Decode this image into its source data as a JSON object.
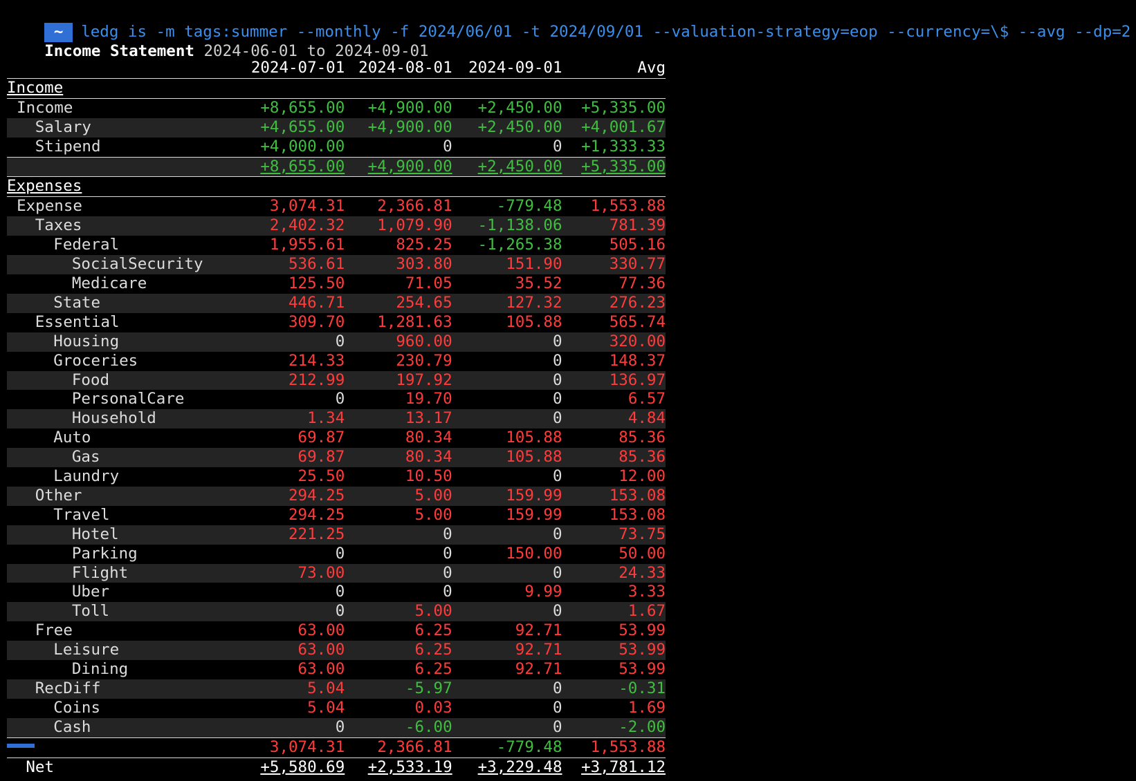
{
  "terminal": {
    "prompt_symbol": "~",
    "command": "ledg is -m tags:summer --monthly -f 2024/06/01 -t 2024/09/01 --valuation-strategy=eop --currency=\\$ --avg --dp=2",
    "title_label": "Income Statement",
    "title_range": "2024-06-01 to 2024-09-01"
  },
  "columns": [
    "2024-07-01",
    "2024-08-01",
    "2024-09-01",
    "Avg"
  ],
  "sections": {
    "income_label": "Income",
    "expenses_label": "Expenses",
    "net_label": "Net"
  },
  "income_rows": [
    {
      "label": "Income",
      "indent": 1,
      "values": [
        "+8,655.00",
        "+4,900.00",
        "+2,450.00",
        "+5,335.00"
      ],
      "kinds": [
        "pos",
        "pos",
        "pos",
        "pos"
      ]
    },
    {
      "label": "Salary",
      "indent": 2,
      "values": [
        "+4,655.00",
        "+4,900.00",
        "+2,450.00",
        "+4,001.67"
      ],
      "kinds": [
        "pos",
        "pos",
        "pos",
        "pos"
      ]
    },
    {
      "label": "Stipend",
      "indent": 2,
      "values": [
        "+4,000.00",
        "0",
        "0",
        "+1,333.33"
      ],
      "kinds": [
        "pos",
        "zero",
        "zero",
        "pos"
      ]
    }
  ],
  "income_total": [
    "+8,655.00",
    "+4,900.00",
    "+2,450.00",
    "+5,335.00"
  ],
  "expense_rows": [
    {
      "label": "Expense",
      "indent": 1,
      "values": [
        "3,074.31",
        "2,366.81",
        "-779.48",
        "1,553.88"
      ],
      "kinds": [
        "neg",
        "neg",
        "pos",
        "neg"
      ]
    },
    {
      "label": "Taxes",
      "indent": 2,
      "values": [
        "2,402.32",
        "1,079.90",
        "-1,138.06",
        "781.39"
      ],
      "kinds": [
        "neg",
        "neg",
        "pos",
        "neg"
      ]
    },
    {
      "label": "Federal",
      "indent": 3,
      "values": [
        "1,955.61",
        "825.25",
        "-1,265.38",
        "505.16"
      ],
      "kinds": [
        "neg",
        "neg",
        "pos",
        "neg"
      ]
    },
    {
      "label": "SocialSecurity",
      "indent": 4,
      "values": [
        "536.61",
        "303.80",
        "151.90",
        "330.77"
      ],
      "kinds": [
        "neg",
        "neg",
        "neg",
        "neg"
      ]
    },
    {
      "label": "Medicare",
      "indent": 4,
      "values": [
        "125.50",
        "71.05",
        "35.52",
        "77.36"
      ],
      "kinds": [
        "neg",
        "neg",
        "neg",
        "neg"
      ]
    },
    {
      "label": "State",
      "indent": 3,
      "values": [
        "446.71",
        "254.65",
        "127.32",
        "276.23"
      ],
      "kinds": [
        "neg",
        "neg",
        "neg",
        "neg"
      ]
    },
    {
      "label": "Essential",
      "indent": 2,
      "values": [
        "309.70",
        "1,281.63",
        "105.88",
        "565.74"
      ],
      "kinds": [
        "neg",
        "neg",
        "neg",
        "neg"
      ]
    },
    {
      "label": "Housing",
      "indent": 3,
      "values": [
        "0",
        "960.00",
        "0",
        "320.00"
      ],
      "kinds": [
        "zero",
        "neg",
        "zero",
        "neg"
      ]
    },
    {
      "label": "Groceries",
      "indent": 3,
      "values": [
        "214.33",
        "230.79",
        "0",
        "148.37"
      ],
      "kinds": [
        "neg",
        "neg",
        "zero",
        "neg"
      ]
    },
    {
      "label": "Food",
      "indent": 4,
      "values": [
        "212.99",
        "197.92",
        "0",
        "136.97"
      ],
      "kinds": [
        "neg",
        "neg",
        "zero",
        "neg"
      ]
    },
    {
      "label": "PersonalCare",
      "indent": 4,
      "values": [
        "0",
        "19.70",
        "0",
        "6.57"
      ],
      "kinds": [
        "zero",
        "neg",
        "zero",
        "neg"
      ]
    },
    {
      "label": "Household",
      "indent": 4,
      "values": [
        "1.34",
        "13.17",
        "0",
        "4.84"
      ],
      "kinds": [
        "neg",
        "neg",
        "zero",
        "neg"
      ]
    },
    {
      "label": "Auto",
      "indent": 3,
      "values": [
        "69.87",
        "80.34",
        "105.88",
        "85.36"
      ],
      "kinds": [
        "neg",
        "neg",
        "neg",
        "neg"
      ]
    },
    {
      "label": "Gas",
      "indent": 4,
      "values": [
        "69.87",
        "80.34",
        "105.88",
        "85.36"
      ],
      "kinds": [
        "neg",
        "neg",
        "neg",
        "neg"
      ]
    },
    {
      "label": "Laundry",
      "indent": 3,
      "values": [
        "25.50",
        "10.50",
        "0",
        "12.00"
      ],
      "kinds": [
        "neg",
        "neg",
        "zero",
        "neg"
      ]
    },
    {
      "label": "Other",
      "indent": 2,
      "values": [
        "294.25",
        "5.00",
        "159.99",
        "153.08"
      ],
      "kinds": [
        "neg",
        "neg",
        "neg",
        "neg"
      ]
    },
    {
      "label": "Travel",
      "indent": 3,
      "values": [
        "294.25",
        "5.00",
        "159.99",
        "153.08"
      ],
      "kinds": [
        "neg",
        "neg",
        "neg",
        "neg"
      ]
    },
    {
      "label": "Hotel",
      "indent": 4,
      "values": [
        "221.25",
        "0",
        "0",
        "73.75"
      ],
      "kinds": [
        "neg",
        "zero",
        "zero",
        "neg"
      ]
    },
    {
      "label": "Parking",
      "indent": 4,
      "values": [
        "0",
        "0",
        "150.00",
        "50.00"
      ],
      "kinds": [
        "zero",
        "zero",
        "neg",
        "neg"
      ]
    },
    {
      "label": "Flight",
      "indent": 4,
      "values": [
        "73.00",
        "0",
        "0",
        "24.33"
      ],
      "kinds": [
        "neg",
        "zero",
        "zero",
        "neg"
      ]
    },
    {
      "label": "Uber",
      "indent": 4,
      "values": [
        "0",
        "0",
        "9.99",
        "3.33"
      ],
      "kinds": [
        "zero",
        "zero",
        "neg",
        "neg"
      ]
    },
    {
      "label": "Toll",
      "indent": 4,
      "values": [
        "0",
        "5.00",
        "0",
        "1.67"
      ],
      "kinds": [
        "zero",
        "neg",
        "zero",
        "neg"
      ]
    },
    {
      "label": "Free",
      "indent": 2,
      "values": [
        "63.00",
        "6.25",
        "92.71",
        "53.99"
      ],
      "kinds": [
        "neg",
        "neg",
        "neg",
        "neg"
      ]
    },
    {
      "label": "Leisure",
      "indent": 3,
      "values": [
        "63.00",
        "6.25",
        "92.71",
        "53.99"
      ],
      "kinds": [
        "neg",
        "neg",
        "neg",
        "neg"
      ]
    },
    {
      "label": "Dining",
      "indent": 4,
      "values": [
        "63.00",
        "6.25",
        "92.71",
        "53.99"
      ],
      "kinds": [
        "neg",
        "neg",
        "neg",
        "neg"
      ]
    },
    {
      "label": "RecDiff",
      "indent": 2,
      "values": [
        "5.04",
        "-5.97",
        "0",
        "-0.31"
      ],
      "kinds": [
        "neg",
        "pos",
        "zero",
        "pos"
      ]
    },
    {
      "label": "Coins",
      "indent": 3,
      "values": [
        "5.04",
        "0.03",
        "0",
        "1.69"
      ],
      "kinds": [
        "neg",
        "neg",
        "zero",
        "neg"
      ]
    },
    {
      "label": "Cash",
      "indent": 3,
      "values": [
        "0",
        "-6.00",
        "0",
        "-2.00"
      ],
      "kinds": [
        "zero",
        "pos",
        "zero",
        "pos"
      ]
    }
  ],
  "expense_total": [
    "3,074.31",
    "2,366.81",
    "-779.48",
    "1,553.88"
  ],
  "expense_total_kinds": [
    "neg",
    "neg",
    "pos",
    "neg"
  ],
  "net_values": [
    "+5,580.69",
    "+2,533.19",
    "+3,229.48",
    "+3,781.12"
  ],
  "colors": {
    "positive": "#3fbf3f",
    "negative": "#ff3b3b",
    "prompt": "#3b8eea",
    "stripe": "#242424"
  }
}
